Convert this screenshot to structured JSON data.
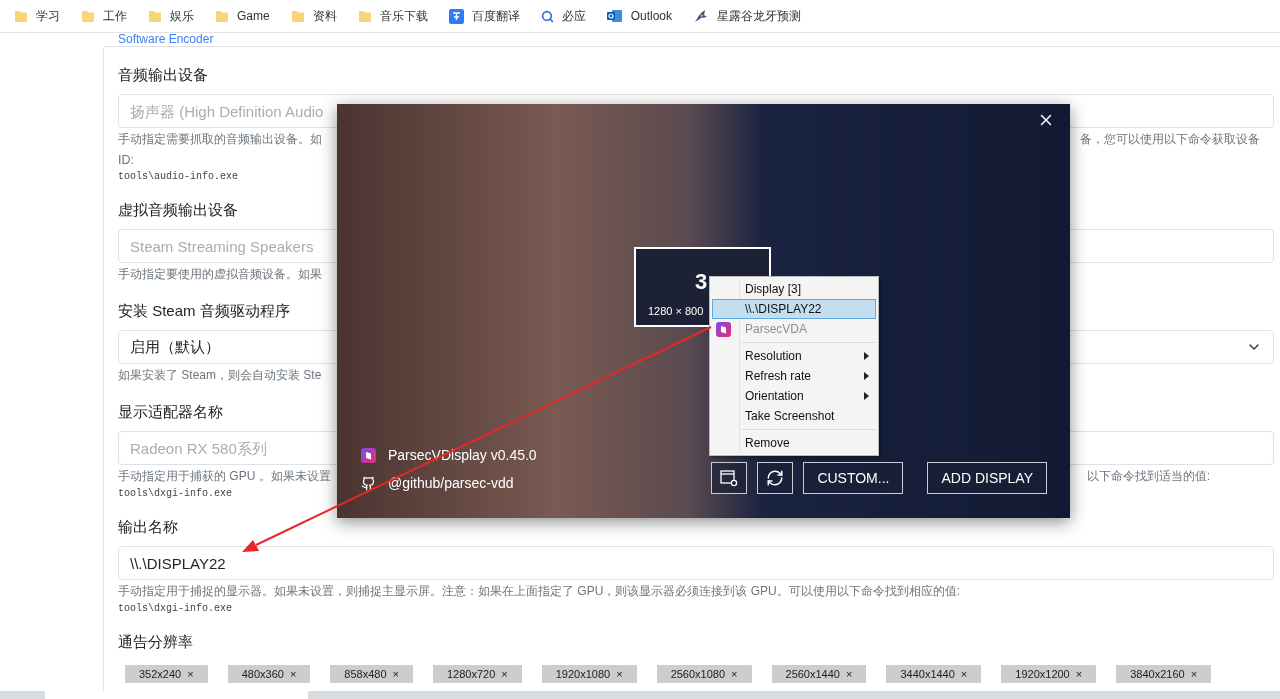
{
  "bookmarks": [
    {
      "kind": "folder",
      "label": "学习"
    },
    {
      "kind": "folder",
      "label": "工作"
    },
    {
      "kind": "folder",
      "label": "娱乐"
    },
    {
      "kind": "folder",
      "label": "Game"
    },
    {
      "kind": "folder",
      "label": "资料"
    },
    {
      "kind": "folder",
      "label": "音乐下载"
    },
    {
      "kind": "translate",
      "label": "百度翻译"
    },
    {
      "kind": "search",
      "label": "必应"
    },
    {
      "kind": "mail",
      "label": "Outlook"
    },
    {
      "kind": "bird",
      "label": "星露谷龙牙预测"
    }
  ],
  "section_link": "Software Encoder",
  "settings": [
    {
      "label": "音频输出设备",
      "kind": "input",
      "placeholder": "扬声器 (High Definition Audio",
      "help_left": "手动指定需要抓取的音频输出设备。如",
      "help_right": "备，您可以使用以下命令获取设备",
      "help_tail": "ID:",
      "command": "tools\\audio-info.exe"
    },
    {
      "label": "虚拟音频输出设备",
      "kind": "input",
      "placeholder": "Steam Streaming Speakers",
      "help_left": "手动指定要使用的虚拟音频设备。如果"
    },
    {
      "label": "安装 Steam 音频驱动程序",
      "kind": "select",
      "value": "启用（默认）",
      "help_left": "如果安装了 Steam，则会自动安装 Ste"
    },
    {
      "label": "显示适配器名称",
      "kind": "input",
      "placeholder": "Radeon RX 580系列",
      "help_left": "手动指定用于捕获的 GPU 。如果未设置",
      "help_right": "以下命令找到适当的值:",
      "command": "tools\\dxgi-info.exe"
    },
    {
      "label": "输出名称",
      "kind": "input",
      "value": "\\\\.\\DISPLAY22",
      "help_left": "手动指定用于捕捉的显示器。如果未设置，则捕捉主显示屏。注意：如果在上面指定了 GPU，则该显示器必须连接到该 GPU。可以使用以下命令找到相应的值:",
      "command": "tools\\dxgi-info.exe"
    },
    {
      "label": "通告分辨率",
      "kind": "tags",
      "tags": [
        {
          "label": "352x240",
          "remove": "×"
        },
        {
          "label": "480x360",
          "remove": "×"
        },
        {
          "label": "858x480",
          "remove": "×"
        },
        {
          "label": "1280x720",
          "remove": "×"
        },
        {
          "label": "1920x1080",
          "remove": "×"
        },
        {
          "label": "2560x1080",
          "remove": "×"
        },
        {
          "label": "2560x1440",
          "remove": "×"
        },
        {
          "label": "3440x1440",
          "remove": "×"
        },
        {
          "label": "1920x1200",
          "remove": "×"
        },
        {
          "label": "3840x2160",
          "remove": "×"
        }
      ]
    }
  ],
  "dialog": {
    "display_number": "3",
    "display_resolution": "1280 × 800",
    "app_name": "ParsecVDisplay v0.45.0",
    "repo": "@github/parsec-vdd",
    "buttons": [
      {
        "kind": "settings"
      },
      {
        "kind": "refresh"
      },
      {
        "kind": "text",
        "label": "CUSTOM..."
      },
      {
        "kind": "text",
        "label": "ADD DISPLAY"
      }
    ],
    "menu": [
      {
        "kind": "item",
        "label": "Display [3]",
        "selected": false,
        "disabled": false,
        "submenu": false
      },
      {
        "kind": "item",
        "label": "\\\\.\\DISPLAY22",
        "selected": true,
        "disabled": false,
        "submenu": false
      },
      {
        "kind": "app_item",
        "label": "ParsecVDA",
        "selected": false,
        "disabled": true,
        "submenu": false
      },
      {
        "kind": "separator"
      },
      {
        "kind": "item",
        "label": "Resolution",
        "selected": false,
        "disabled": false,
        "submenu": true
      },
      {
        "kind": "item",
        "label": "Refresh rate",
        "selected": false,
        "disabled": false,
        "submenu": true
      },
      {
        "kind": "item",
        "label": "Orientation",
        "selected": false,
        "disabled": false,
        "submenu": true
      },
      {
        "kind": "item",
        "label": "Take Screenshot",
        "selected": false,
        "disabled": false,
        "submenu": false
      },
      {
        "kind": "separator"
      },
      {
        "kind": "item",
        "label": "Remove",
        "selected": false,
        "disabled": false,
        "submenu": false
      }
    ]
  }
}
